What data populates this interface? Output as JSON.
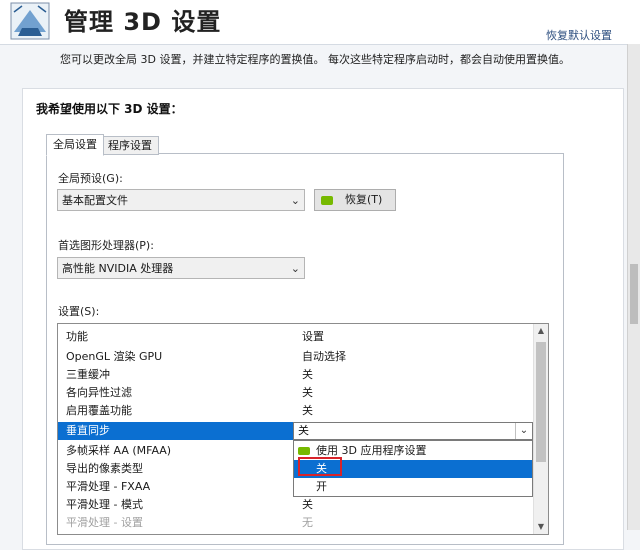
{
  "header": {
    "title": "管理 3D 设置",
    "restore_defaults": "恢复默认设置"
  },
  "description": "您可以更改全局 3D 设置，并建立特定程序的置换值。 每次这些特定程序启动时，都会自动使用置换值。",
  "section_title": "我希望使用以下 3D 设置：",
  "tabs": [
    {
      "label": "全局设置",
      "active": true
    },
    {
      "label": "程序设置",
      "active": false
    }
  ],
  "global_preset": {
    "label": "全局预设(G):",
    "value": "基本配置文件",
    "restore_button": "恢复(T)"
  },
  "preferred_gpu": {
    "label": "首选图形处理器(P):",
    "value": "高性能 NVIDIA 处理器"
  },
  "settings": {
    "label": "设置(S):",
    "columns": [
      "功能",
      "设置"
    ],
    "rows": [
      {
        "feature": "OpenGL 渲染 GPU",
        "value": "自动选择"
      },
      {
        "feature": "三重缓冲",
        "value": "关"
      },
      {
        "feature": "各向异性过滤",
        "value": "关"
      },
      {
        "feature": "启用覆盖功能",
        "value": "关"
      },
      {
        "feature": "垂直同步",
        "value": "关"
      },
      {
        "feature": "多帧采样 AA (MFAA)",
        "value": ""
      },
      {
        "feature": "导出的像素类型",
        "value": ""
      },
      {
        "feature": "平滑处理 - FXAA",
        "value": ""
      },
      {
        "feature": "平滑处理 - 模式",
        "value": "关"
      },
      {
        "feature": "平滑处理 - 设置",
        "value": "无"
      }
    ],
    "selected_row": "垂直同步"
  },
  "vsync_combo": {
    "value": "关",
    "options": [
      {
        "label": "使用 3D 应用程序设置",
        "icon": "nvidia-icon"
      },
      {
        "label": "关",
        "selected": true
      },
      {
        "label": "开"
      }
    ]
  },
  "colors": {
    "selection": "#0b6fd1",
    "highlight_box": "#d8232a",
    "nvidia_green": "#76b900"
  }
}
